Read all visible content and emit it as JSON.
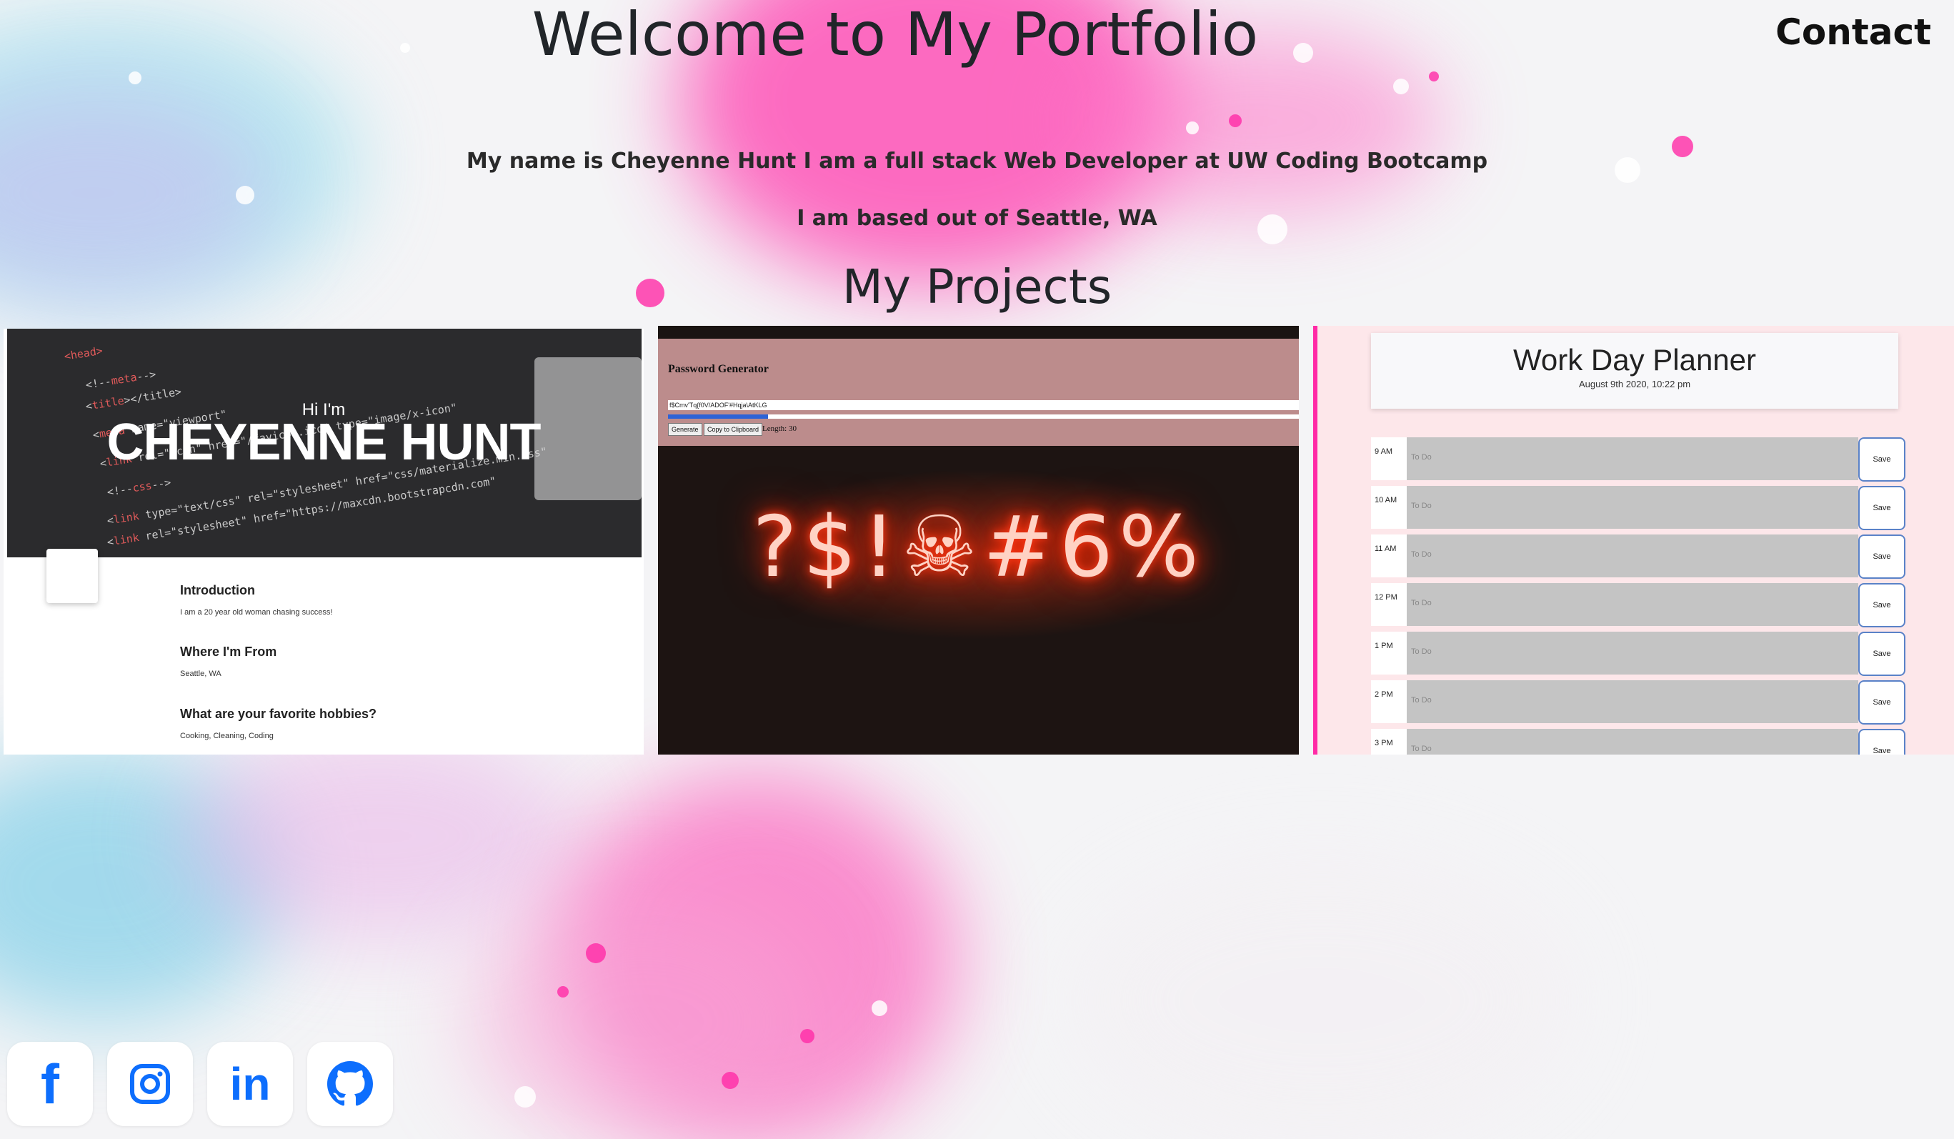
{
  "header": {
    "title": "Welcome to My Portfolio",
    "contact_label": "Contact"
  },
  "intro": {
    "line1": "My name is Cheyenne Hunt I am a full stack Web Developer at UW Coding Bootcamp",
    "line2": "I am based out of Seattle, WA"
  },
  "projects": {
    "title": "My Projects",
    "portfolio_card": {
      "hi": "Hi I'm",
      "name": "CHEYENNE HUNT",
      "sections": [
        {
          "heading": "Introduction",
          "text": "I am a 20 year old woman chasing success!"
        },
        {
          "heading": "Where I'm From",
          "text": "Seattle, WA"
        },
        {
          "heading": "What are your favorite hobbies?",
          "text": "Cooking, Cleaning, Coding"
        }
      ]
    },
    "password_card": {
      "title": "Password Generator",
      "password_value": "f$Cmv'Tq{f0V/ADOF'#Hqja\\AtKLG",
      "generate_label": "Generate",
      "copy_label": "Copy to Clipboard",
      "length_label": "Length: 30",
      "neon_text": "?$!☠#6%"
    },
    "planner_card": {
      "title": "Work Day Planner",
      "date": "August 9th 2020, 10:22 pm",
      "placeholder": "To Do",
      "save_label": "Save",
      "hours": [
        "9 AM",
        "10 AM",
        "11 AM",
        "12 PM",
        "1 PM",
        "2 PM",
        "3 PM"
      ]
    }
  },
  "socials": [
    {
      "name": "facebook-icon",
      "glyph": "f"
    },
    {
      "name": "instagram-icon"
    },
    {
      "name": "linkedin-icon",
      "glyph": "in"
    },
    {
      "name": "github-icon"
    }
  ],
  "colors": {
    "accent_pink": "#ff2aa6",
    "accent_cyan": "#7fd8ea",
    "social_blue": "#0d6efd"
  }
}
